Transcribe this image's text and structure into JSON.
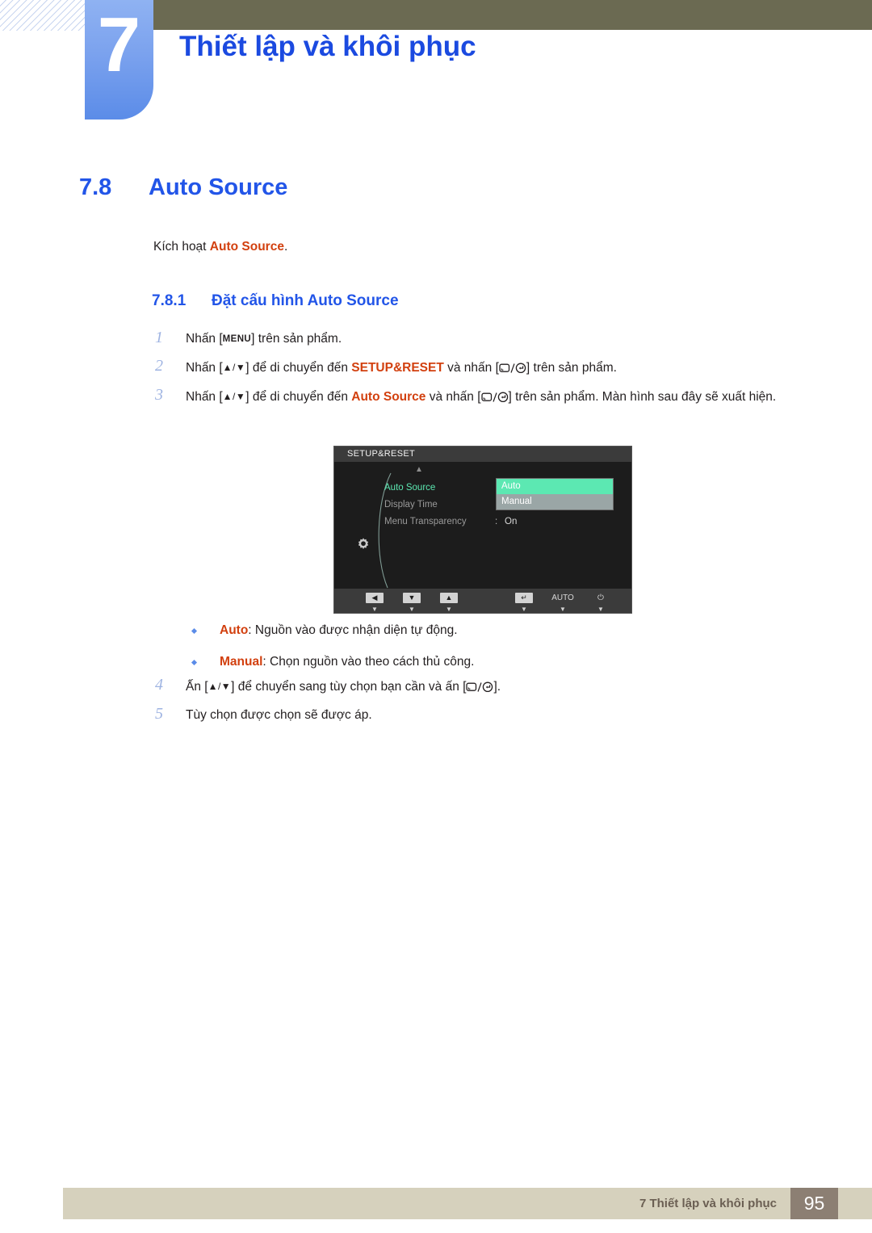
{
  "header": {
    "chapter_number": "7",
    "chapter_title": "Thiết lập và khôi phục"
  },
  "section": {
    "number": "7.8",
    "title": "Auto Source",
    "intro_prefix": "Kích hoạt ",
    "intro_highlight": "Auto Source",
    "intro_suffix": ".",
    "sub_number": "7.8.1",
    "sub_title": "Đặt cấu hình Auto Source"
  },
  "steps": [
    {
      "num": "1",
      "parts": [
        {
          "type": "text",
          "text": "Nhấn ["
        },
        {
          "type": "key",
          "text": "MENU"
        },
        {
          "type": "text",
          "text": "] trên sản phẩm."
        }
      ]
    },
    {
      "num": "2",
      "parts": [
        {
          "type": "text",
          "text": "Nhấn ["
        },
        {
          "type": "tri",
          "text": "▲/▼"
        },
        {
          "type": "text",
          "text": "] để di chuyển đến "
        },
        {
          "type": "hl",
          "text": "SETUP&RESET"
        },
        {
          "type": "text",
          "text": " và nhấn ["
        },
        {
          "type": "keyglyph",
          "text": "□/↵"
        },
        {
          "type": "text",
          "text": "] trên sản phẩm."
        }
      ]
    },
    {
      "num": "3",
      "parts": [
        {
          "type": "text",
          "text": "Nhấn ["
        },
        {
          "type": "tri",
          "text": "▲/▼"
        },
        {
          "type": "text",
          "text": "] để di chuyển đến "
        },
        {
          "type": "hl",
          "text": "Auto Source"
        },
        {
          "type": "text",
          "text": " và nhấn ["
        },
        {
          "type": "keyglyph",
          "text": "□/↵"
        },
        {
          "type": "text",
          "text": "] trên sản phẩm. Màn hình sau đây sẽ xuất hiện."
        }
      ]
    }
  ],
  "steps2": [
    {
      "num": "4",
      "parts": [
        {
          "type": "text",
          "text": "Ấn ["
        },
        {
          "type": "tri",
          "text": "▲/▼"
        },
        {
          "type": "text",
          "text": "] để chuyển sang tùy chọn bạn cần và ấn ["
        },
        {
          "type": "keyglyph",
          "text": "□/↵"
        },
        {
          "type": "text",
          "text": "]."
        }
      ]
    },
    {
      "num": "5",
      "parts": [
        {
          "type": "text",
          "text": "Tùy chọn được chọn sẽ được áp."
        }
      ]
    }
  ],
  "osd": {
    "title": "SETUP&RESET",
    "scroll_up_indicator": "▲",
    "rows": [
      {
        "label": "Auto Source",
        "state": "active",
        "colon": ":",
        "value": ""
      },
      {
        "label": "Display Time",
        "state": "dim",
        "colon": ":",
        "value": ""
      },
      {
        "label": "Menu Transparency",
        "state": "dim",
        "colon": ":",
        "value": "On"
      }
    ],
    "dropdown": [
      {
        "label": "Auto",
        "selected": true
      },
      {
        "label": "Manual",
        "selected": false
      }
    ],
    "footer_buttons": [
      {
        "kind": "box",
        "glyph": "◀",
        "sub": "▼"
      },
      {
        "kind": "box",
        "glyph": "▼",
        "sub": "▼"
      },
      {
        "kind": "box",
        "glyph": "▲",
        "sub": "▼"
      },
      {
        "kind": "box",
        "glyph": "↵",
        "sub": "▼"
      },
      {
        "kind": "text",
        "glyph": "AUTO",
        "sub": "▼"
      },
      {
        "kind": "text",
        "glyph": "⏻",
        "sub": "▼"
      }
    ]
  },
  "bullets": [
    {
      "label": "Auto",
      "text": ": Nguồn vào được nhận diện tự động."
    },
    {
      "label": "Manual",
      "text": ": Chọn nguồn vào theo cách thủ công."
    }
  ],
  "footer": {
    "text": "7 Thiết lập và khôi phục",
    "page": "95"
  },
  "colors": {
    "heading_blue": "#2255e8",
    "title_blue": "#1b4ae0",
    "highlight_orange": "#d2400f",
    "step_number_blue": "#9fb4e2",
    "tab_blue": "#5b8ce8",
    "olive": "#6b6a52",
    "footer_beige": "#d6d1bd",
    "footer_page_box": "#8c7f73",
    "osd_green": "#5ce8b2",
    "osd_gray": "#9aa6a6"
  }
}
